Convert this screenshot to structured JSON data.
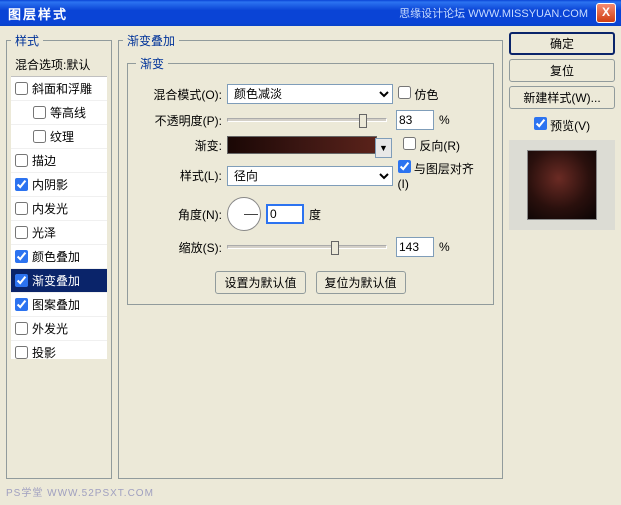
{
  "window": {
    "title": "图层样式",
    "credit": "思缘设计论坛  WWW.MISSYUAN.COM",
    "close": "X"
  },
  "styles": {
    "legend": "样式",
    "header": "混合选项:默认",
    "items": [
      {
        "label": "斜面和浮雕",
        "checked": false,
        "indent": false
      },
      {
        "label": "等高线",
        "checked": false,
        "indent": true
      },
      {
        "label": "纹理",
        "checked": false,
        "indent": true
      },
      {
        "label": "描边",
        "checked": false,
        "indent": false
      },
      {
        "label": "内阴影",
        "checked": true,
        "indent": false
      },
      {
        "label": "内发光",
        "checked": false,
        "indent": false
      },
      {
        "label": "光泽",
        "checked": false,
        "indent": false
      },
      {
        "label": "颜色叠加",
        "checked": true,
        "indent": false
      },
      {
        "label": "渐变叠加",
        "checked": true,
        "indent": false,
        "selected": true
      },
      {
        "label": "图案叠加",
        "checked": true,
        "indent": false
      },
      {
        "label": "外发光",
        "checked": false,
        "indent": false
      },
      {
        "label": "投影",
        "checked": false,
        "indent": false
      }
    ]
  },
  "gradient": {
    "legend": "渐变叠加",
    "innerLegend": "渐变",
    "labels": {
      "blend": "混合模式(O):",
      "opacity": "不透明度(P):",
      "grad": "渐变:",
      "style": "样式(L):",
      "angle": "角度(N):",
      "scale": "缩放(S):",
      "degree": "度",
      "percent": "%"
    },
    "checkbox": {
      "dither": "仿色",
      "reverse": "反向(R)",
      "align": "与图层对齐(I)"
    },
    "values": {
      "blend": "颜色减淡",
      "opacity": "83",
      "style": "径向",
      "angle": "0",
      "scale": "143",
      "ditherChecked": false,
      "reverseChecked": false,
      "alignChecked": true
    },
    "buttons": {
      "setDefault": "设置为默认值",
      "resetDefault": "复位为默认值"
    }
  },
  "right": {
    "ok": "确定",
    "cancel": "复位",
    "newStyle": "新建样式(W)...",
    "preview": "预览(V)",
    "previewChecked": true
  },
  "footer": {
    "a": "PS学堂",
    "b": "WWW.52PSXT.COM"
  }
}
